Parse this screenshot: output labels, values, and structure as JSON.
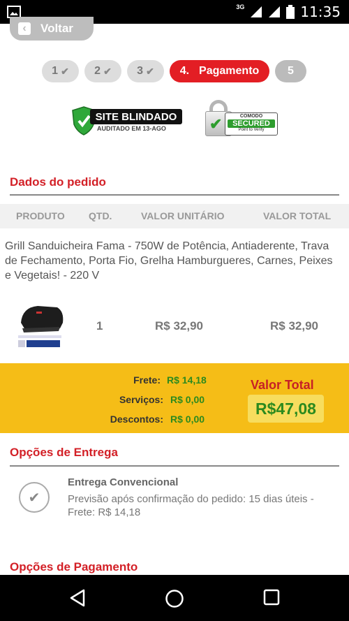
{
  "status_bar": {
    "network": "3G",
    "time": "11:35"
  },
  "back_button": {
    "label": "Voltar"
  },
  "steps": [
    {
      "number": "1"
    },
    {
      "number": "2"
    },
    {
      "number": "3"
    },
    {
      "number": "4.",
      "label": "Pagamento"
    },
    {
      "number": "5"
    }
  ],
  "badges": {
    "site_blindado": {
      "title": "SITE BLINDADO",
      "subtitle": "AUDITADO EM 13-AGO"
    },
    "comodo": {
      "brand": "COMODO",
      "status": "SECURED",
      "caption": "Point to Verify"
    }
  },
  "order": {
    "title": "Dados do pedido",
    "columns": [
      "PRODUTO",
      "QTD.",
      "VALOR UNITÁRIO",
      "VALOR TOTAL"
    ],
    "product_name": "Grill Sanduicheira Fama - 750W de Potência, Antiaderente, Trava de Fechamento, Porta Fio, Grelha Hamburgueres, Carnes, Peixes e Vegetais! - 220 V",
    "quantity": "1",
    "unit_price": "R$ 32,90",
    "total_price": "R$ 32,90"
  },
  "totals": {
    "frete_label": "Frete:",
    "frete_value": "R$ 14,18",
    "servicos_label": "Serviços:",
    "servicos_value": "R$ 0,00",
    "descontos_label": "Descontos:",
    "descontos_value": "R$ 0,00",
    "valor_total_label": "Valor Total",
    "valor_total_value": "R$47,08"
  },
  "delivery": {
    "title": "Opções de Entrega",
    "option_title": "Entrega Convencional",
    "option_desc": "Previsão após confirmação do pedido: 15 dias úteis - Frete: R$ 14,18"
  },
  "payment": {
    "title": "Opções de Pagamento"
  },
  "colors": {
    "brand_red": "#e31e24",
    "totals_yellow": "#f5bd17",
    "money_green": "#2c8a1e"
  }
}
